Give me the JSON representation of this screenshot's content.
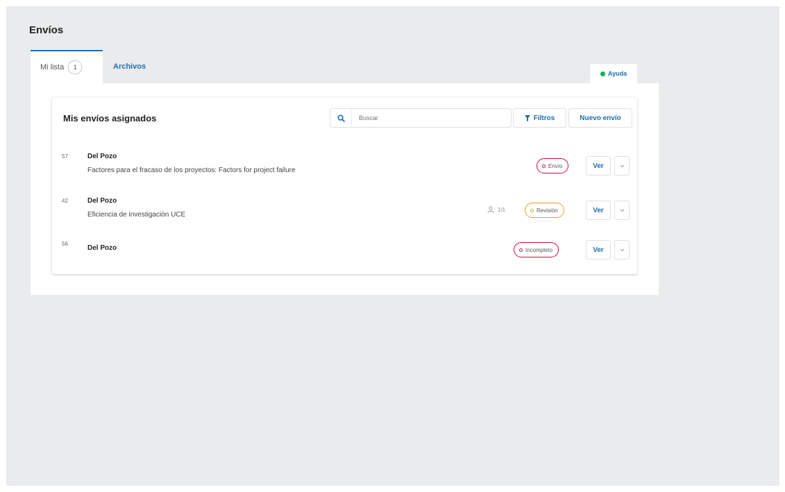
{
  "page": {
    "title": "Envíos"
  },
  "tabs": [
    {
      "label": "Mi lista",
      "count": "1"
    },
    {
      "label": "Archivos"
    }
  ],
  "help": {
    "label": "Ayuda",
    "icon": "help-circle-icon"
  },
  "card": {
    "title": "Mis envíos asignados",
    "search": {
      "placeholder": "Buscar",
      "value": "",
      "icon": "search-icon"
    },
    "filters_label": "Filtros",
    "new_label": "Nuevo envío"
  },
  "submissions": [
    {
      "id": "57",
      "author": "Del Pozo",
      "title": "Factores para el fracaso de los proyectos: Factors for project failure",
      "status": "Envío",
      "status_color": "#d00a3a",
      "view_label": "Ver"
    },
    {
      "id": "42",
      "author": "Del Pozo",
      "title": "Eficiencia de investigación UCE",
      "reviews": "1/1",
      "status": "Revisión",
      "status_color": "#e0a51e",
      "view_label": "Ver"
    },
    {
      "id": "56",
      "author": "Del Pozo",
      "title": "",
      "status": "Incompleto",
      "status_color": "#d00a3a",
      "view_label": "Ver"
    }
  ],
  "colors": {
    "accent": "#1e6fb1",
    "background": "#e9ebec",
    "help_dot": "#00b24e"
  }
}
